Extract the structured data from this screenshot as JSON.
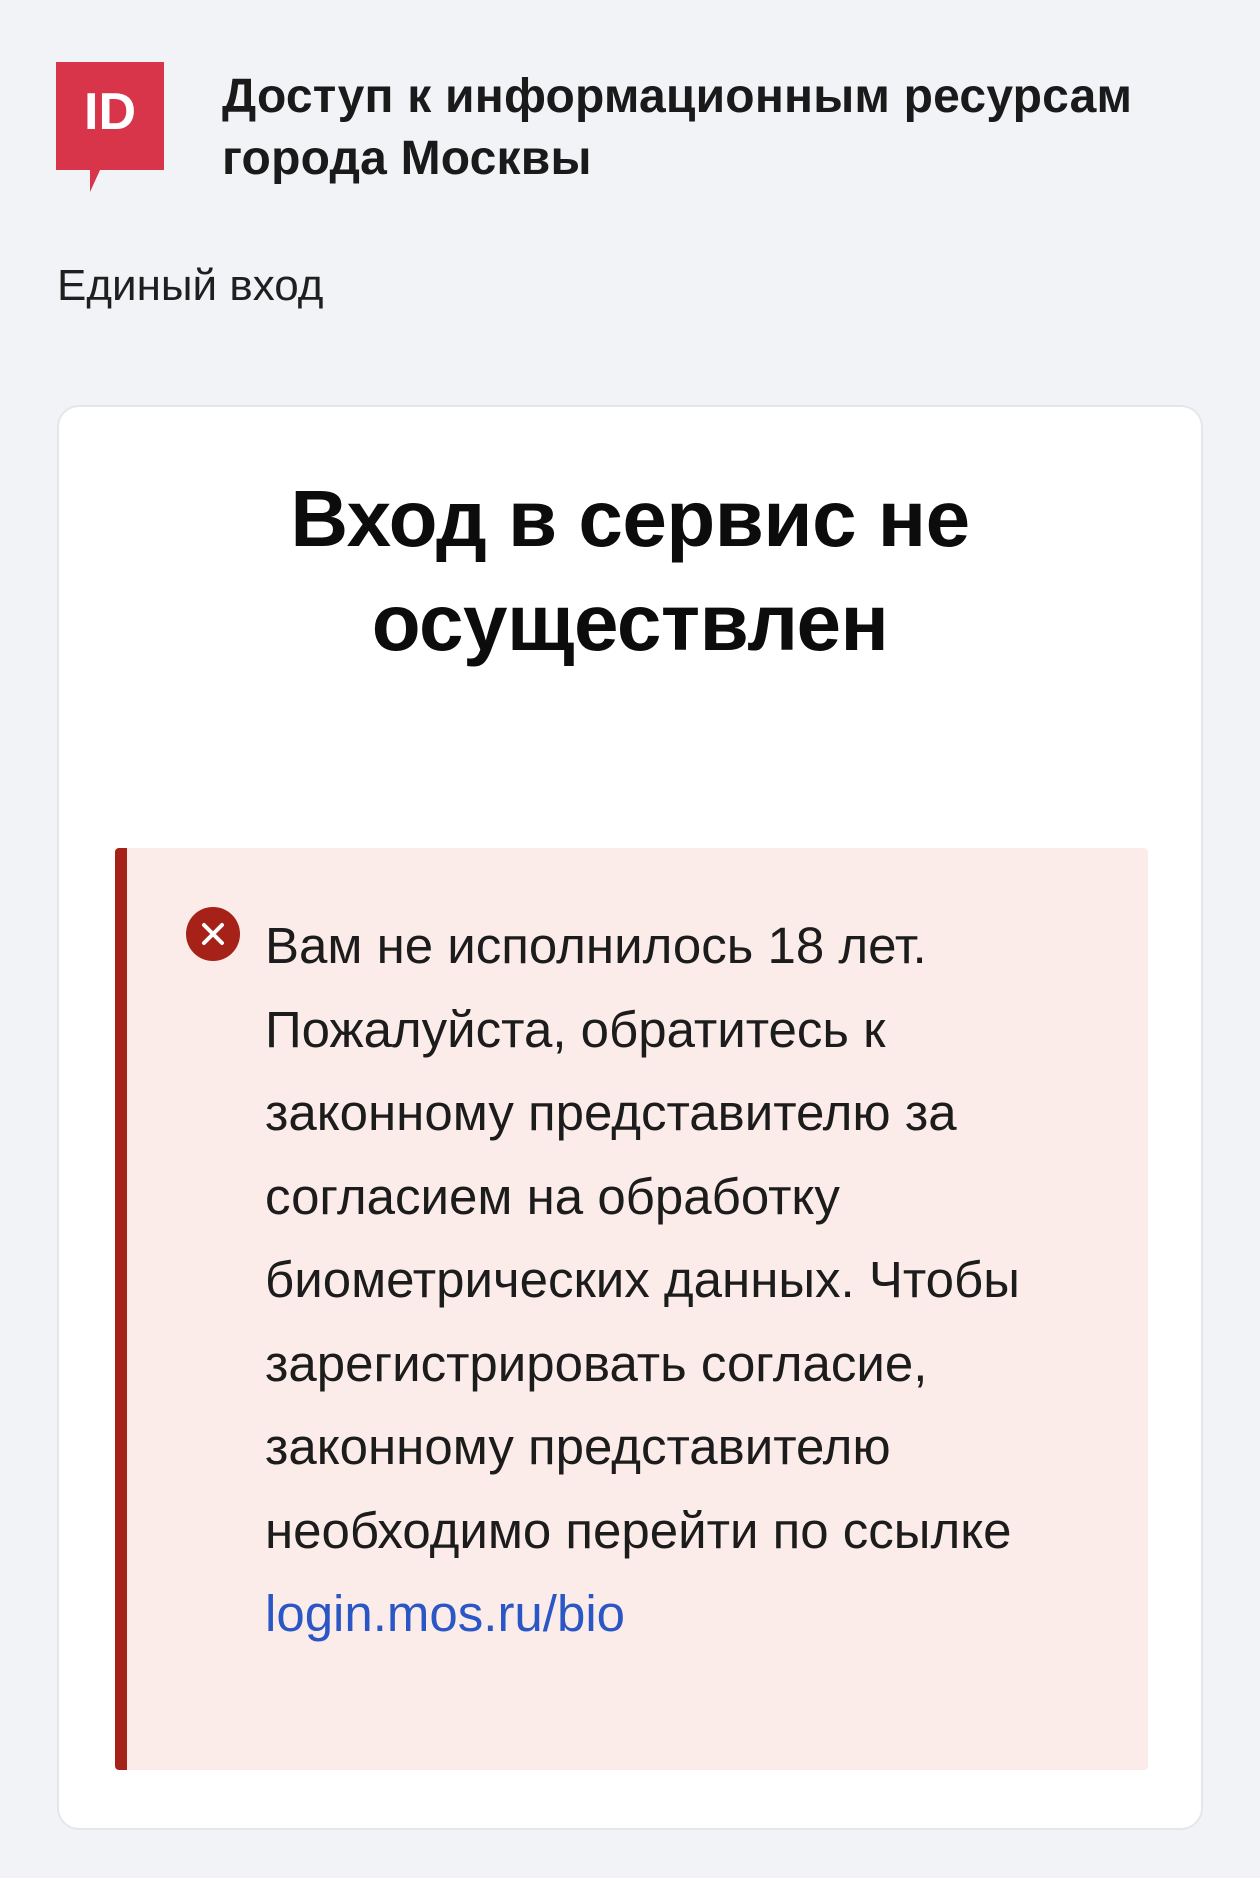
{
  "colors": {
    "background": "#f2f3f6",
    "logo_red": "#d8344a",
    "alert_background": "#fbece9",
    "alert_accent": "#a62219",
    "link": "#2a56c6"
  },
  "header": {
    "logo_text": "ID",
    "logo_icon": "id-logo-icon",
    "title": "Доступ к информационным ресурсам города Москвы"
  },
  "subtitle": "Единый вход",
  "card": {
    "title": "Вход в сервис не осуществлен",
    "alert": {
      "icon": "error-circle-x-icon",
      "message": "Вам не исполнилось 18 лет. Пожалуйста, обратитесь к законному представителю за согласием на обработку биометрических данных. Чтобы зарегистрировать согласие, законному представителю необходимо перейти по ссылке",
      "link_label": "login.mos.ru/bio"
    }
  }
}
